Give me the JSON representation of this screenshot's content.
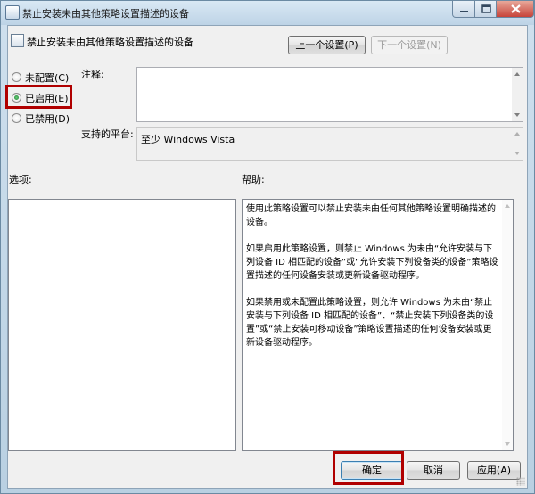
{
  "window": {
    "title": "禁止安装未由其他策略设置描述的设备"
  },
  "header": {
    "policy_name": "禁止安装未由其他策略设置描述的设备",
    "prev_button": "上一个设置(P)",
    "next_button": "下一个设置(N)"
  },
  "state": {
    "options": [
      {
        "label": "未配置(C)",
        "checked": false
      },
      {
        "label": "已启用(E)",
        "checked": true
      },
      {
        "label": "已禁用(D)",
        "checked": false
      }
    ]
  },
  "comment": {
    "label": "注释:",
    "value": ""
  },
  "platform": {
    "label": "支持的平台:",
    "value": "至少 Windows Vista"
  },
  "options_section": {
    "label": "选项:"
  },
  "help": {
    "label": "帮助:",
    "paragraphs": [
      "使用此策略设置可以禁止安装未由任何其他策略设置明确描述的设备。",
      "如果启用此策略设置，则禁止 Windows 为未由“允许安装与下列设备 ID 相匹配的设备”或“允许安装下列设备类的设备”策略设置描述的任何设备安装或更新设备驱动程序。",
      "如果禁用或未配置此策略设置，则允许 Windows 为未由“禁止安装与下列设备 ID 相匹配的设备”、“禁止安装下列设备类的设置”或“禁止安装可移动设备”策略设置描述的任何设备安装或更新设备驱动程序。"
    ]
  },
  "footer": {
    "ok_button": "确定",
    "cancel_button": "取消",
    "apply_button": "应用(A)"
  },
  "colors": {
    "highlight": "#b00000",
    "window_frame": "#b9d0e2",
    "dialog_bg": "#f0f0f0"
  }
}
